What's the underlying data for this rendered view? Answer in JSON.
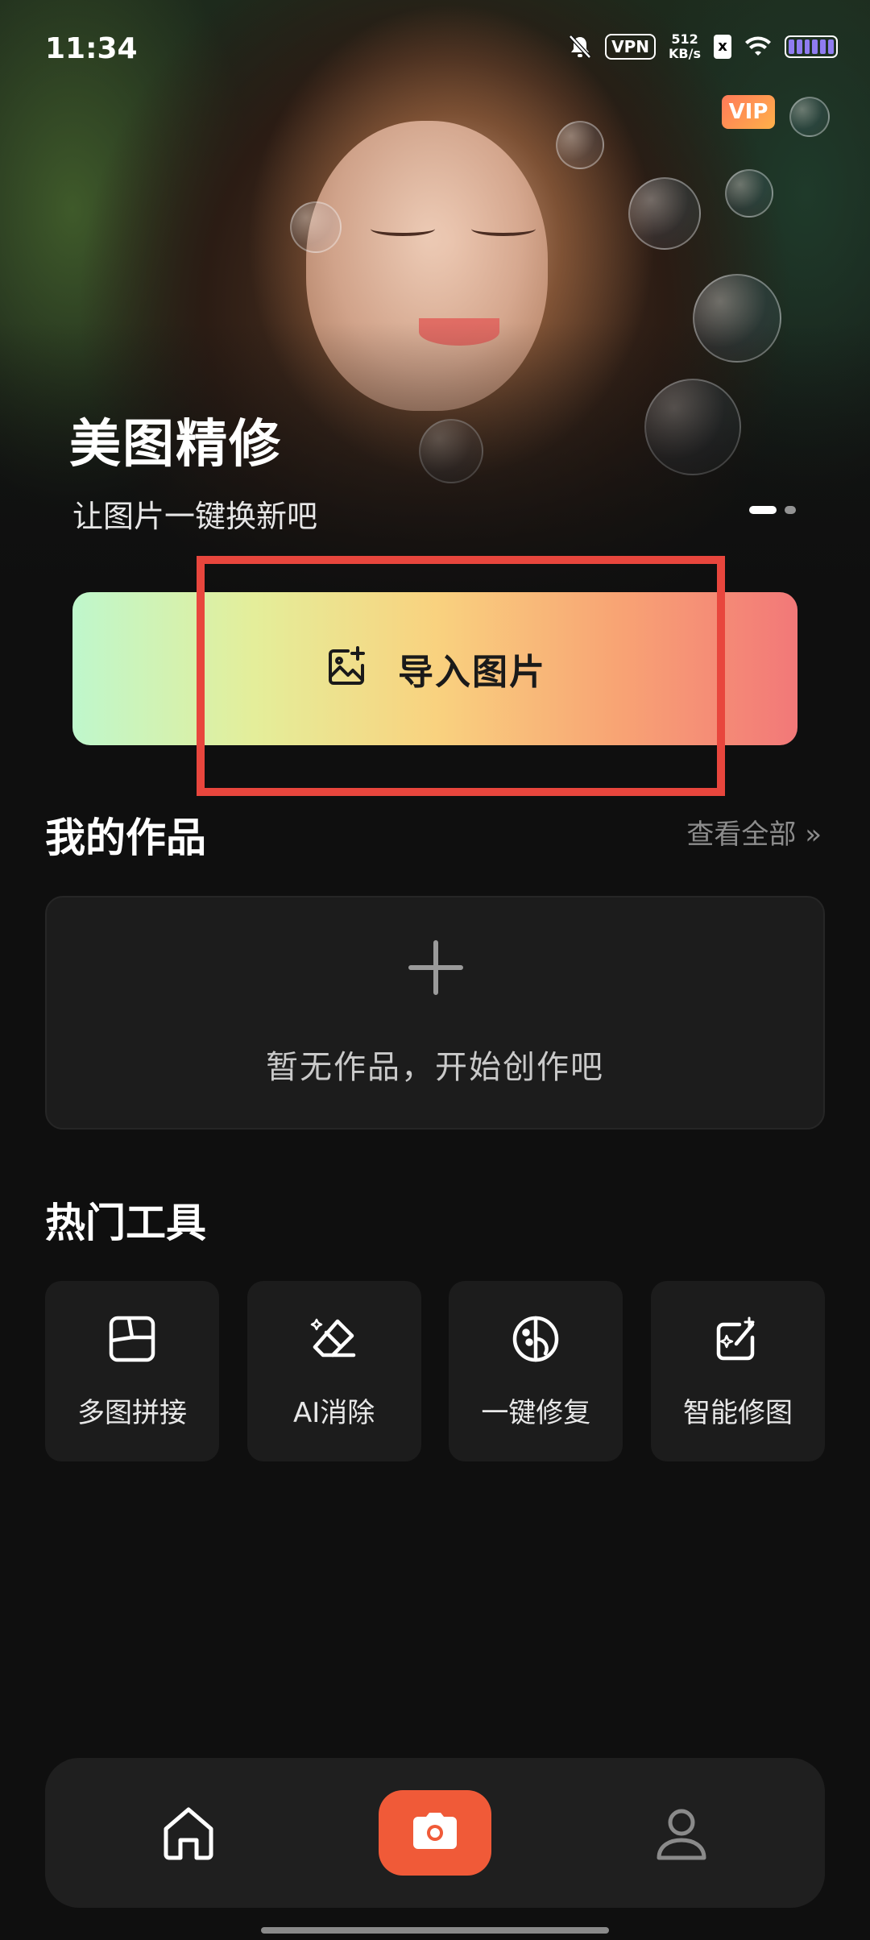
{
  "status_bar": {
    "time": "11:34",
    "vpn": "VPN",
    "speed_value": "512",
    "speed_unit": "KB/s",
    "sim": "x"
  },
  "hero": {
    "vip_badge": "VIP",
    "title": "美图精修",
    "subtitle": "让图片一键换新吧"
  },
  "import": {
    "label": "导入图片",
    "icon": "add-image-icon"
  },
  "my_works": {
    "title": "我的作品",
    "view_all": "查看全部 »",
    "empty_text": "暂无作品，开始创作吧"
  },
  "hot_tools": {
    "title": "热门工具",
    "items": [
      {
        "label": "多图拼接",
        "icon": "collage-icon"
      },
      {
        "label": "AI消除",
        "icon": "eraser-icon"
      },
      {
        "label": "一键修复",
        "icon": "restore-icon"
      },
      {
        "label": "智能修图",
        "icon": "magic-edit-icon"
      }
    ]
  },
  "bottom_nav": {
    "items": [
      "home-icon",
      "camera-icon",
      "profile-icon"
    ]
  },
  "colors": {
    "accent_camera": "#f05a38",
    "highlight_box": "#e8463d",
    "card_bg": "#1c1c1c"
  }
}
